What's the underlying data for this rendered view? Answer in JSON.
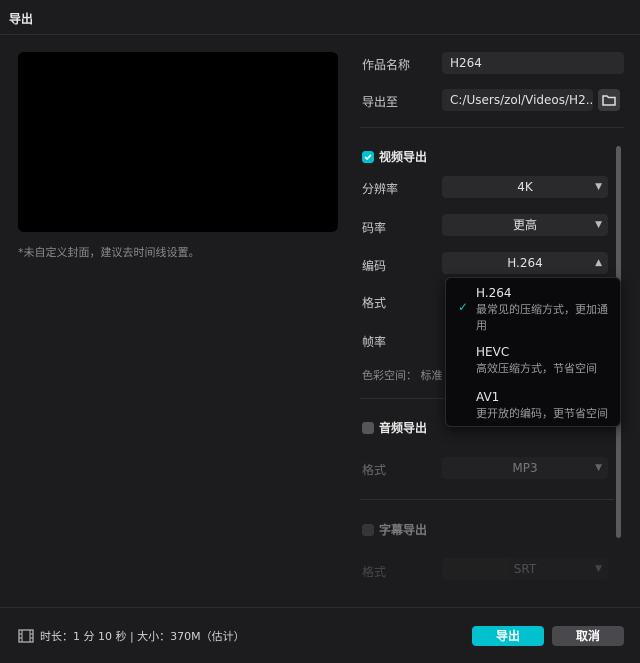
{
  "window": {
    "title": "导出"
  },
  "preview": {
    "hint": "*未自定义封面，建议去时间线设置。"
  },
  "form": {
    "name_label": "作品名称",
    "name_value": "H264",
    "path_label": "导出至",
    "path_value": "C:/Users/zol/Videos/H2...",
    "folder_icon": "folder-icon"
  },
  "video": {
    "label": "视频导出",
    "checked": true,
    "resolution_label": "分辨率",
    "resolution_value": "4K",
    "bitrate_label": "码率",
    "bitrate_value": "更高",
    "codec_label": "编码",
    "codec_value": "H.264",
    "format_label": "格式",
    "framerate_label": "帧率",
    "colorspace_label": "色彩空间：",
    "colorspace_value": "标准"
  },
  "codec_dropdown": {
    "options": [
      {
        "title": "H.264",
        "desc": "最常见的压缩方式，更加通用",
        "selected": true
      },
      {
        "title": "HEVC",
        "desc": "高效压缩方式，节省空间",
        "selected": false
      },
      {
        "title": "AV1",
        "desc": "更开放的编码，更节省空间",
        "selected": false
      }
    ]
  },
  "audio": {
    "label": "音频导出",
    "checked": false,
    "format_label": "格式",
    "format_value": "MP3"
  },
  "subtitle": {
    "label": "字幕导出",
    "checked": false,
    "format_label": "格式",
    "format_value": "SRT"
  },
  "footer": {
    "info": "时长：1 分 10 秒 | 大小：370M（估计）",
    "export_label": "导出",
    "cancel_label": "取消"
  },
  "colors": {
    "accent": "#00c1cd"
  }
}
